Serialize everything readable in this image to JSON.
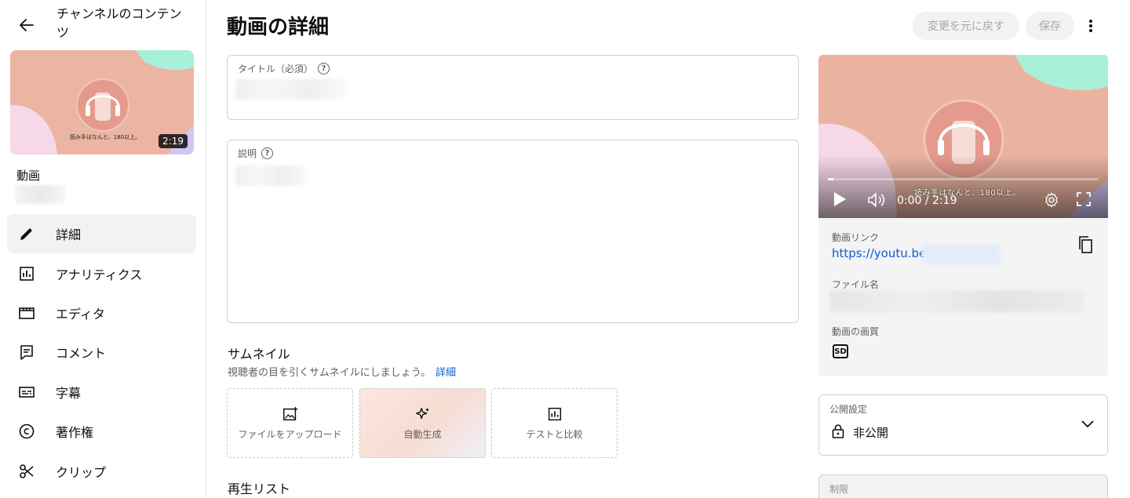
{
  "sidebar": {
    "back_label": "",
    "channel_title": "チャンネルのコンテンツ",
    "thumbnail": {
      "duration": "2:19",
      "caption": "読み手はなんと、180以上。"
    },
    "video_label": "動画",
    "items": [
      {
        "label": "詳細",
        "icon": "pencil-icon",
        "active": true
      },
      {
        "label": "アナリティクス",
        "icon": "analytics-icon",
        "active": false
      },
      {
        "label": "エディタ",
        "icon": "editor-icon",
        "active": false
      },
      {
        "label": "コメント",
        "icon": "comment-icon",
        "active": false
      },
      {
        "label": "字幕",
        "icon": "subtitles-icon",
        "active": false
      },
      {
        "label": "著作権",
        "icon": "copyright-icon",
        "active": false
      },
      {
        "label": "クリップ",
        "icon": "scissors-icon",
        "active": false
      }
    ]
  },
  "header": {
    "title": "動画の詳細",
    "undo_label": "変更を元に戻す",
    "save_label": "保存"
  },
  "form": {
    "title_label": "タイトル（必須）",
    "description_label": "説明"
  },
  "thumbnail_section": {
    "title": "サムネイル",
    "description": "視聴者の目を引くサムネイルにしましょう。",
    "details_link": "詳細",
    "options": [
      {
        "label": "ファイルをアップロード",
        "icon": "upload-image-icon"
      },
      {
        "label": "自動生成",
        "icon": "sparkle-icon"
      },
      {
        "label": "テストと比較",
        "icon": "chart-icon"
      }
    ]
  },
  "playlist_section": {
    "title": "再生リスト"
  },
  "player": {
    "time": "0:00 / 2:19",
    "caption": "読み手はなんと、180以上。",
    "progress": 0.02
  },
  "video_meta": {
    "link_label": "動画リンク",
    "link_value": "https://youtu.be/",
    "filename_label": "ファイル名",
    "quality_label": "動画の画質",
    "quality_badge": "SD"
  },
  "visibility": {
    "label": "公開設定",
    "value": "非公開"
  },
  "restrictions": {
    "label": "制限"
  },
  "colors": {
    "accent_link": "#065fd4",
    "thumb_peach": "#ecb4a2",
    "thumb_mint": "#a9f0d9",
    "thumb_pink": "#f6d8e8",
    "thumb_lavender": "#cfc6f2"
  }
}
